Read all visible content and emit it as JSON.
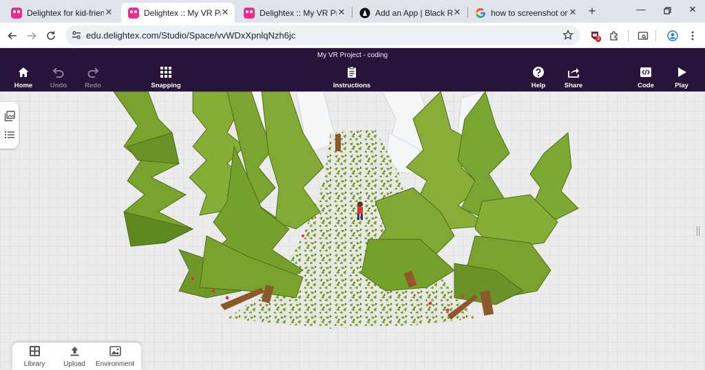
{
  "browser": {
    "tabs": [
      {
        "title": "Delightex for kid-friendly",
        "favicon": "delightex-icon",
        "active": false
      },
      {
        "title": "Delightex :: My VR Project",
        "favicon": "delightex-icon",
        "active": true
      },
      {
        "title": "Delightex :: My VR Project",
        "favicon": "delightex-icon",
        "active": false
      },
      {
        "title": "Add an App | Black Rocket",
        "favicon": "black-rocket-icon",
        "active": false
      },
      {
        "title": "how to screenshot on pc",
        "favicon": "google-icon",
        "active": false
      }
    ],
    "url": "edu.delightex.com/Studio/Space/vvWDxXpnlqNzh6jc",
    "extension_badge": "3"
  },
  "app": {
    "project_title": "My VR Project - coding",
    "buttons": {
      "home": "Home",
      "undo": "Undo",
      "redo": "Redo",
      "snapping": "Snapping",
      "instructions": "Instructions",
      "help": "Help",
      "share": "Share",
      "code": "Code",
      "play": "Play"
    },
    "bottom_panel": {
      "library": "Library",
      "upload": "Upload",
      "environment": "Environment"
    }
  },
  "colors": {
    "header": "#28143a",
    "tree": "#7aa32e",
    "grass": "#6e9a2a",
    "ground": "#e9e9e9",
    "accent": "#e8308a"
  }
}
